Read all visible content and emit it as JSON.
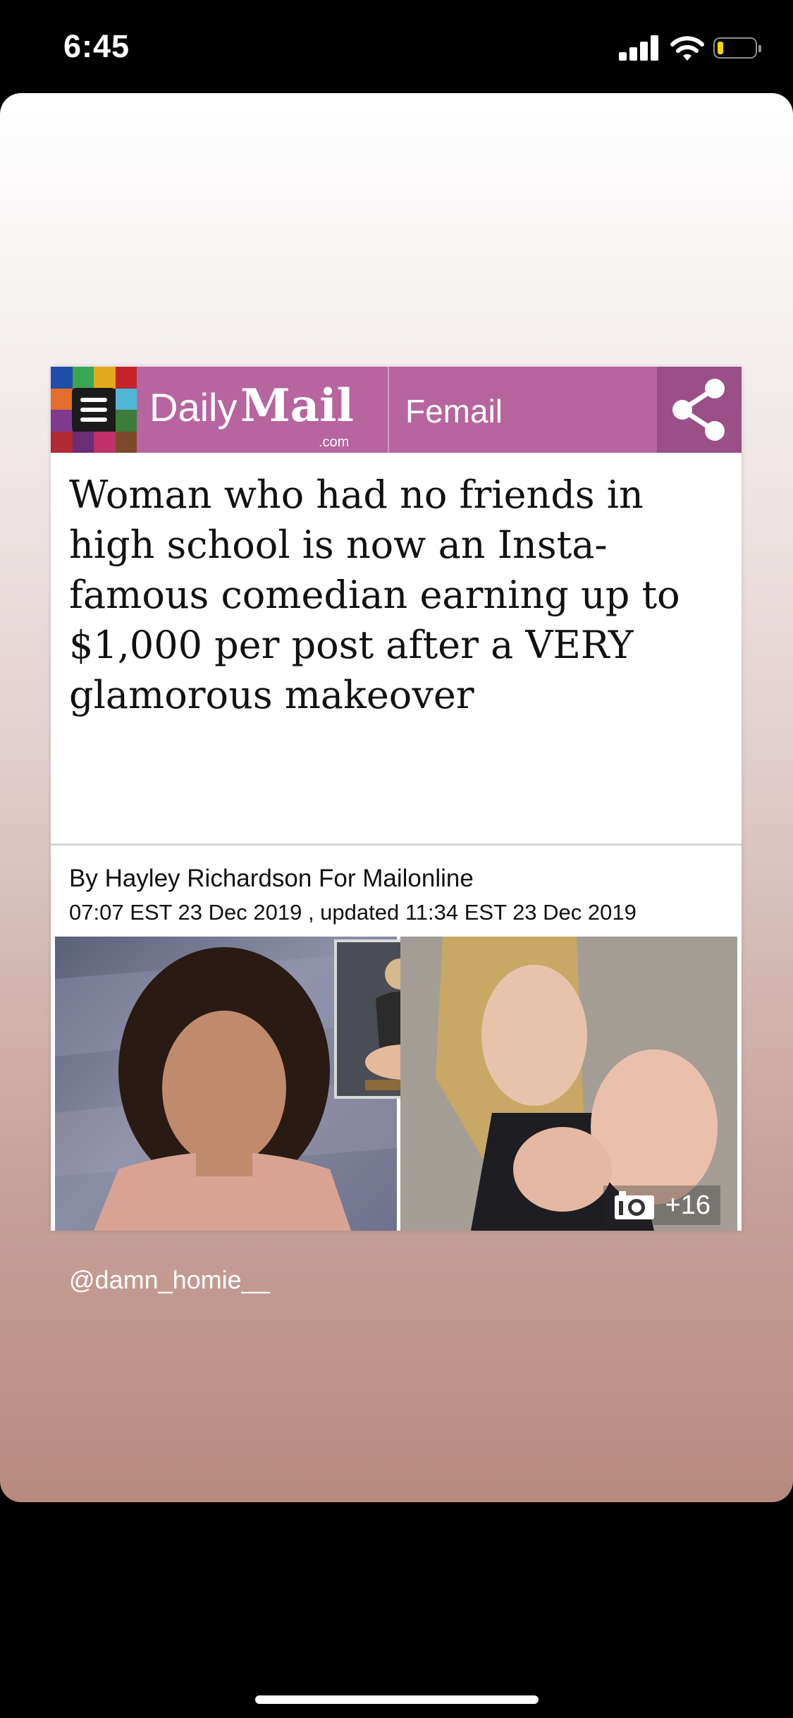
{
  "status_bar": {
    "time": "6:45"
  },
  "article": {
    "brand": {
      "daily": "Daily",
      "mail": "Mail",
      "com": ".com"
    },
    "section": "Femail",
    "mosaic_colors": [
      "#1f4fa8",
      "#3aa655",
      "#e3a81e",
      "#c4232a",
      "#e36d2c",
      "#1b1b1b",
      "#1b1b1b",
      "#52b7d6",
      "#7e3b8e",
      "#1b1b1b",
      "#1b1b1b",
      "#3e7c3a",
      "#b02a33",
      "#6a2d76",
      "#c1326a",
      "#7a4a2b"
    ],
    "headline": "Woman who had no friends in high school is now an Insta-famous comedian earning up to $1,000 per post after a VERY glamorous makeover",
    "byline": "By Hayley Richardson For Mailonline",
    "dateline": "07:07 EST 23 Dec 2019 , updated 11:34 EST 23 Dec 2019",
    "gallery_count": "+16",
    "brand_color": "#b6659e"
  },
  "story": {
    "handle": "@damn_homie__"
  }
}
